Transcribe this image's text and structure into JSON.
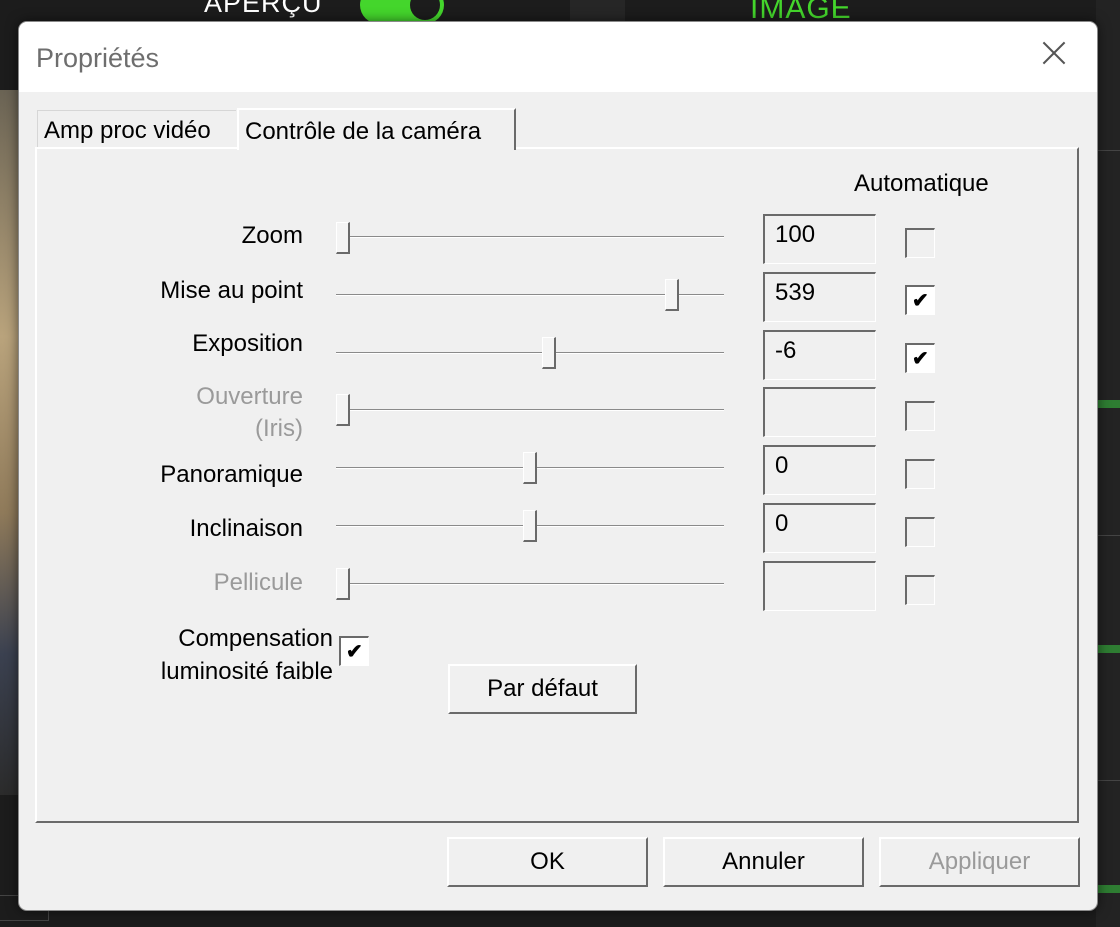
{
  "background_app": {
    "preview_label": "APERÇU",
    "image_label": "IMAGE",
    "accent_color": "#44d62c"
  },
  "dialog": {
    "title": "Propriétés",
    "close_icon": "close-icon",
    "tabs": [
      {
        "label": "Amp proc vidéo",
        "active": false
      },
      {
        "label": "Contrôle de la caméra",
        "active": true
      }
    ],
    "auto_header": "Automatique",
    "rows": [
      {
        "label": "Zoom",
        "value": "100",
        "slider_fraction": 0.0,
        "auto": false,
        "enabled": true
      },
      {
        "label": "Mise au point",
        "value": "539",
        "slider_fraction": 0.88,
        "auto": true,
        "enabled": true
      },
      {
        "label": "Exposition",
        "value": "-6",
        "slider_fraction": 0.55,
        "auto": true,
        "enabled": true
      },
      {
        "label_line1": "Ouverture",
        "label_line2": "(Iris)",
        "value": "",
        "slider_fraction": 0.0,
        "auto": false,
        "enabled": false
      },
      {
        "label": "Panoramique",
        "value": "0",
        "slider_fraction": 0.5,
        "auto": false,
        "enabled": true
      },
      {
        "label": "Inclinaison",
        "value": "0",
        "slider_fraction": 0.5,
        "auto": false,
        "enabled": true
      },
      {
        "label": "Pellicule",
        "value": "",
        "slider_fraction": 0.0,
        "auto": false,
        "enabled": false
      }
    ],
    "low_light": {
      "line1": "Compensation",
      "line2": "luminosité faible",
      "checked": true
    },
    "default_button": "Par défaut",
    "buttons": {
      "ok": "OK",
      "cancel": "Annuler",
      "apply": "Appliquer"
    }
  }
}
